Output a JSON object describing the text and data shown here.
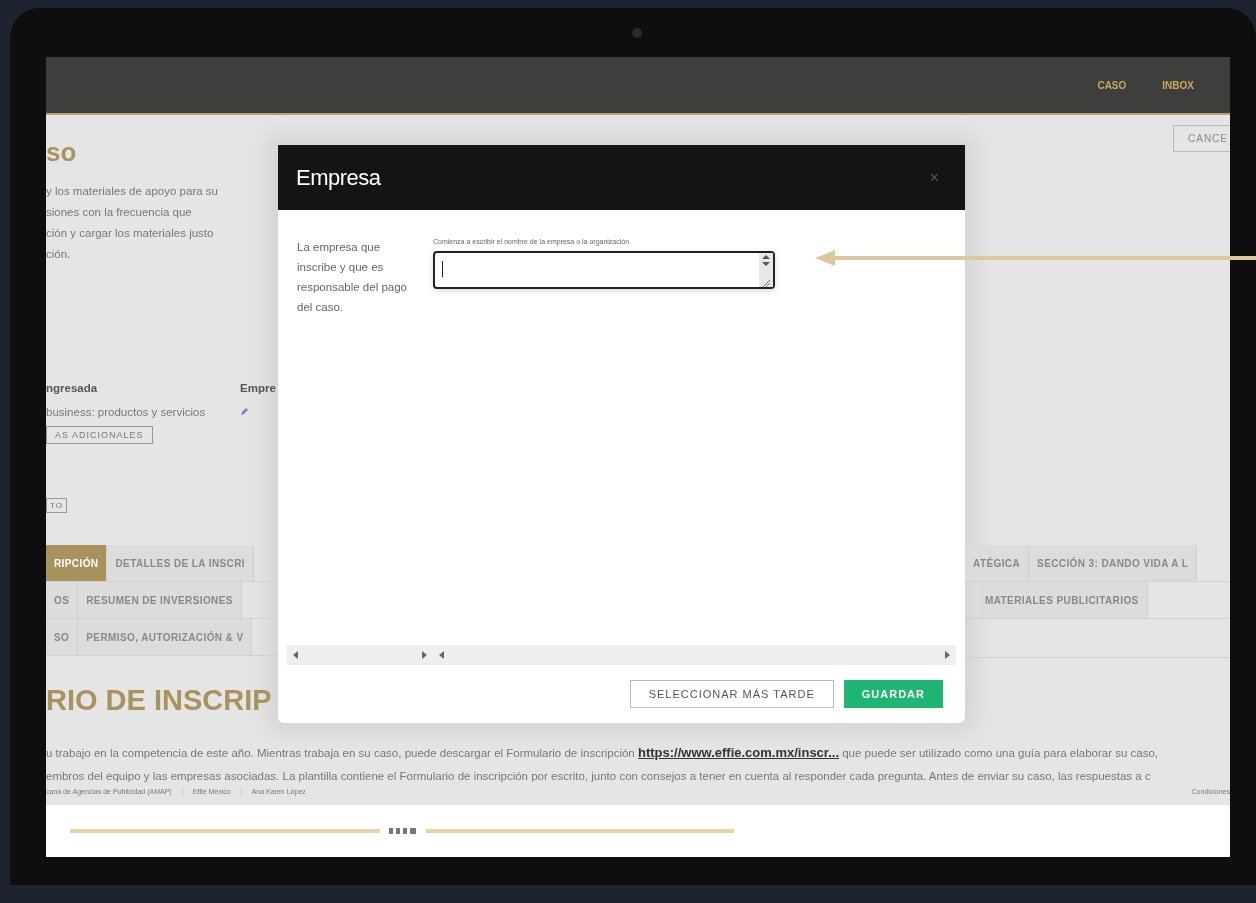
{
  "nav": {
    "items": [
      {
        "label": "CASO"
      },
      {
        "label": "INBOX"
      }
    ]
  },
  "left_panel": {
    "title": "so",
    "description_lines": [
      "y los materiales de apoyo para su",
      "siones con la frecuencia que",
      "ción y cargar los materiales justo",
      "ción."
    ],
    "category_label": "ngresada",
    "category_value": "business: productos y servicios",
    "category_button": "AS ADICIONALES",
    "company_label": "Empre",
    "small_button": "TO",
    "tab_rows": [
      [
        {
          "label": "RIPCIÓN",
          "selected": true
        },
        {
          "label": "DETALLES DE LA INSCRI",
          "selected": false
        }
      ],
      [
        {
          "label": "OS",
          "selected": false
        },
        {
          "label": "RESUMEN DE INVERSIONES",
          "selected": false
        }
      ],
      [
        {
          "label": "SO",
          "selected": false
        },
        {
          "label": "PERMISO, AUTORIZACIÓN & V",
          "selected": false
        }
      ]
    ],
    "form_heading": "RIO DE INSCRIP"
  },
  "right_panel": {
    "cancel_button": "CANCE",
    "tab_rows": [
      [
        {
          "label": "ATÉGICA",
          "selected": false
        },
        {
          "label": "SECCIÓN 3: DANDO VIDA A L",
          "selected": false
        }
      ],
      [
        {
          "label": "MATERIALES PUBLICITARIOS",
          "selected": false
        }
      ]
    ]
  },
  "intro": {
    "line_1": {
      "before": "u trabajo en la competencia de este año. Mientras trabaja en su caso, puede descargar el Formulario de inscripción",
      "link": "https://www.effie.com.mx/inscr...",
      "after": "que puede ser utilizado como una guía para elaborar su caso,"
    },
    "line_2": "embros del equipo y las empresas asociadas. La plantilla contiene el Formulario de inscripción por escrito, junto con consejos a tener en cuenta al responder cada pregunta. Antes de enviar su caso, las respuestas a c"
  },
  "footer": {
    "credits": [
      "cana de Agencias de Publicidad (AMAP)",
      "Effie Mexico",
      "Ana Karen López"
    ],
    "terms": "Condiciones"
  },
  "dialog": {
    "title": "Empresa",
    "close": "×",
    "description": "La empresa que inscribe y que es responsable del pago del caso.",
    "field": {
      "label": "Comienza a escribir el nombre de la empresa o la organización"
    },
    "buttons": [
      {
        "label": "SELECCIONAR MÁS TARDE",
        "kind": "secondary"
      },
      {
        "label": "GUARDAR",
        "kind": "primary"
      }
    ]
  }
}
